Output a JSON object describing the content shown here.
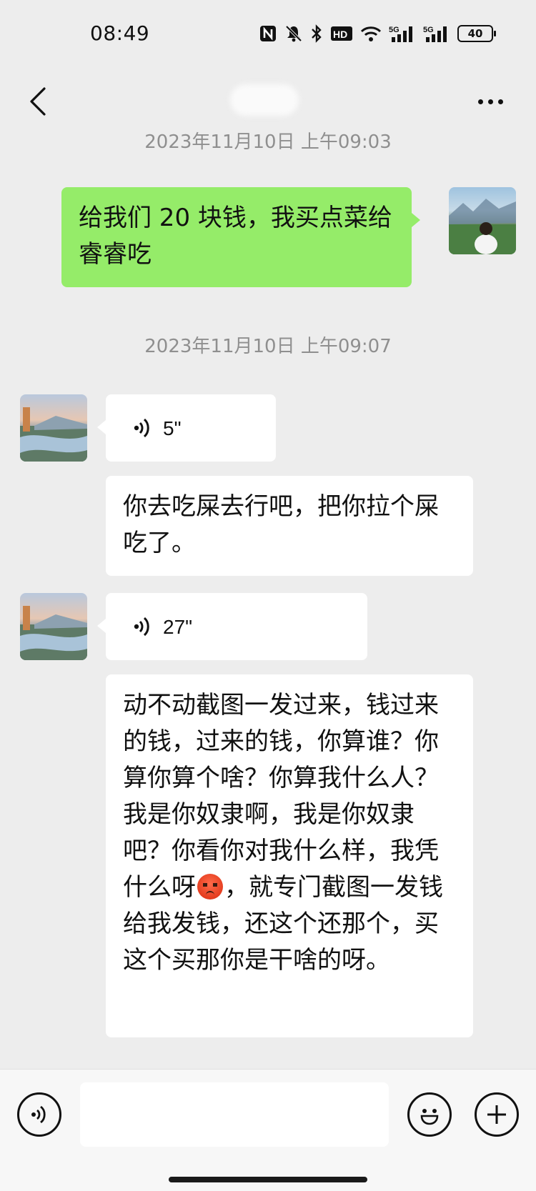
{
  "status_bar": {
    "time": "08:49",
    "icons": [
      "nfc-icon",
      "mute-icon",
      "bluetooth-icon",
      "hd-icon",
      "wifi-icon",
      "signal-5g-icon",
      "signal-5g-icon",
      "battery-icon"
    ],
    "hd_label": "HD",
    "net_label_1": "5G",
    "net_label_2": "5G",
    "battery_level": "40"
  },
  "header": {
    "back_icon": "back-arrow-icon",
    "contact_name": "",
    "more_icon": "more-dots-icon"
  },
  "chat": {
    "messages": [
      {
        "type": "timestamp",
        "text": "2023年11月10日 上午09:03"
      },
      {
        "type": "text",
        "sender": "self",
        "text": "给我们 20 块钱，我买点菜给睿睿吃"
      },
      {
        "type": "timestamp",
        "text": "2023年11月10日 上午09:07"
      },
      {
        "type": "voice",
        "sender": "other",
        "duration": "5\""
      },
      {
        "type": "text",
        "sender": "other",
        "text": "你去吃屎去行吧，把你拉个屎吃了。"
      },
      {
        "type": "voice",
        "sender": "other",
        "duration": "27\""
      },
      {
        "type": "text",
        "sender": "other",
        "text_before_emoji": "动不动截图一发过来，钱过来的钱，过来的钱，你算谁？你算你算个啥？你算我什么人？我是你奴隶啊，我是你奴隶吧？你看你对我什么样，我凭什么呀",
        "emoji": "angry-face-emoji",
        "text_after_emoji": "，就专门截图一发钱给我发钱，还这个还那个，买这个买那你是干啥的呀。"
      }
    ]
  },
  "input_bar": {
    "voice_icon": "voice-input-icon",
    "input_value": "",
    "emoji_icon": "emoji-icon",
    "plus_icon": "plus-icon"
  },
  "colors": {
    "background": "#ededed",
    "self_bubble": "#95ec69",
    "other_bubble": "#ffffff",
    "timestamp_text": "#8f8f8f"
  }
}
